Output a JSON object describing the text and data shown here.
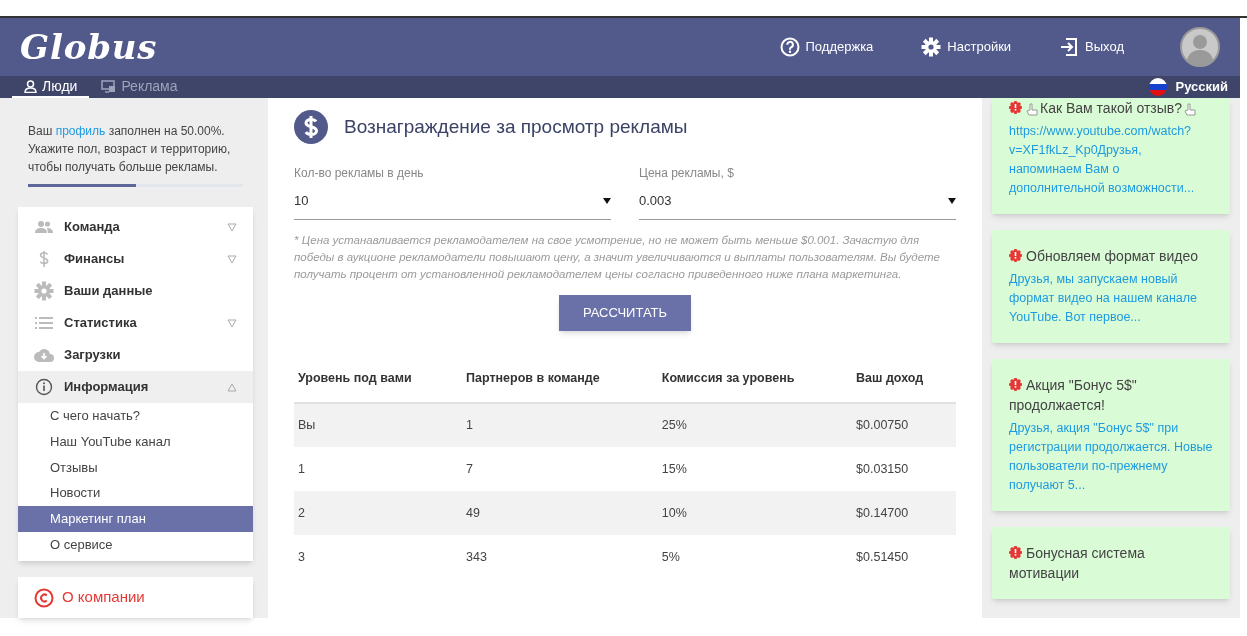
{
  "header": {
    "logo": "Globus",
    "links": [
      {
        "label": "Поддержка"
      },
      {
        "label": "Настройки"
      },
      {
        "label": "Выход"
      }
    ]
  },
  "tabs": [
    {
      "label": "Люди",
      "selected": true
    },
    {
      "label": "Реклама",
      "selected": false
    }
  ],
  "language": "Русский",
  "profile": {
    "before": "Ваш ",
    "link": "профиль",
    "after": " заполнен на 50.00%. Укажите пол, возраст и территорию, чтобы получать больше рекламы.",
    "level": 0.5
  },
  "menu": [
    {
      "label": "Команда",
      "expanded": false
    },
    {
      "label": "Финансы",
      "expanded": false
    },
    {
      "label": "Ваши данные"
    },
    {
      "label": "Статистика",
      "expanded": false
    },
    {
      "label": "Загрузки"
    },
    {
      "label": "Информация",
      "expanded": true,
      "children": [
        {
          "label": "С чего начать?",
          "selected": false
        },
        {
          "label": "Наш YouTube канал",
          "selected": false
        },
        {
          "label": "Отзывы",
          "selected": false
        },
        {
          "label": "Новости",
          "selected": false
        },
        {
          "label": "Маркетинг план",
          "selected": true
        },
        {
          "label": "О сервисе",
          "selected": false
        }
      ]
    }
  ],
  "about": "О компании",
  "main": {
    "title": "Вознаграждение за просмотр рекламы",
    "fields": [
      {
        "label": "Кол-во рекламы в день",
        "value": "10"
      },
      {
        "label": "Цена рекламы, $",
        "value": "0.003"
      }
    ],
    "note": "* Цена устанавливается рекламодателем на свое усмотрение, но не может быть меньше $0.001. Зачастую для победы в аукционе рекламодатели повышают цену, а значит увеличиваются и выплаты пользователям. Вы будете получать процент от установленной рекламодателем цены согласно приведенного ниже плана маркетинга.",
    "button": "РАССЧИТАТЬ",
    "table": {
      "columns": [
        "Уровень под вами",
        "Партнеров в команде",
        "Комиссия за уровень",
        "Ваш доход"
      ],
      "rows": [
        [
          "Вы",
          "1",
          "25%",
          "$0.00750"
        ],
        [
          "1",
          "7",
          "15%",
          "$0.03150"
        ],
        [
          "2",
          "49",
          "10%",
          "$0.14700"
        ],
        [
          "3",
          "343",
          "5%",
          "$0.51450"
        ]
      ]
    }
  },
  "news": [
    {
      "title": "Как Вам такой отзыв?",
      "pointing_hands": true,
      "body": "https://www.youtube.com/watch?v=XF1fkLz_Kp0Друзья, напоминаем Вам о дополнительной возможности..."
    },
    {
      "title": "Обновляем формат видео",
      "body": "Друзья, мы запускаем новый формат видео на нашем канале YouTube. Вот первое..."
    },
    {
      "title": "Акция \"Бонус 5$\" продолжается!",
      "body": "Друзья, акция \"Бонус 5$\" при регистрации продолжается. Новые пользователи по-прежнему получают 5..."
    },
    {
      "title": "Бонусная система мотивации"
    }
  ]
}
